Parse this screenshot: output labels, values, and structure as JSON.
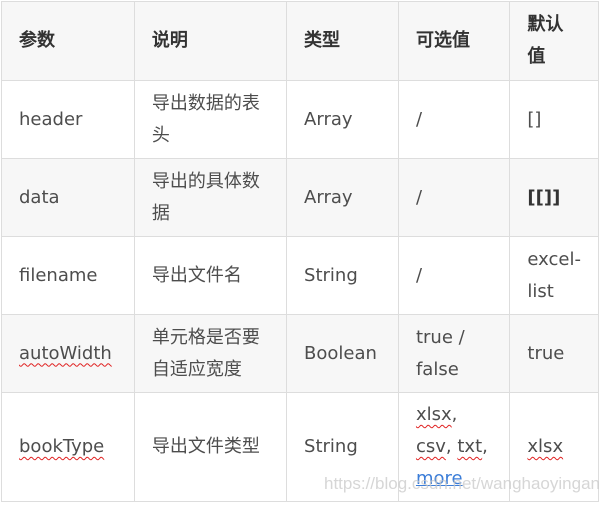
{
  "table": {
    "headers": [
      "参数",
      "说明",
      "类型",
      "可选值",
      "默认值"
    ],
    "rows": [
      {
        "param": "header",
        "desc": "导出数据的表头",
        "type": "Array",
        "options": "/",
        "default": "[]"
      },
      {
        "param": "data",
        "desc": "导出的具体数据",
        "type": "Array",
        "options": "/",
        "default": "[[]]"
      },
      {
        "param": "filename",
        "desc": "导出文件名",
        "type": "String",
        "options": "/",
        "default": "excel-list"
      },
      {
        "param": "autoWidth",
        "desc": "单元格是否要自适应宽度",
        "type": "Boolean",
        "options": "true / false",
        "default": "true"
      },
      {
        "param": "bookType",
        "desc": "导出文件类型",
        "type": "String",
        "options_parts": [
          "xlsx",
          ", ",
          "csv",
          ", ",
          "txt",
          ", "
        ],
        "options_link": "more",
        "default": "xlsx"
      }
    ]
  },
  "watermark": "https://blog.csdn.net/wanghaoyingand",
  "colors": {
    "header_bg": "#f7f7f7",
    "border": "#dddddd",
    "link": "#3b7dd8",
    "spellcheck": "#e02020"
  }
}
